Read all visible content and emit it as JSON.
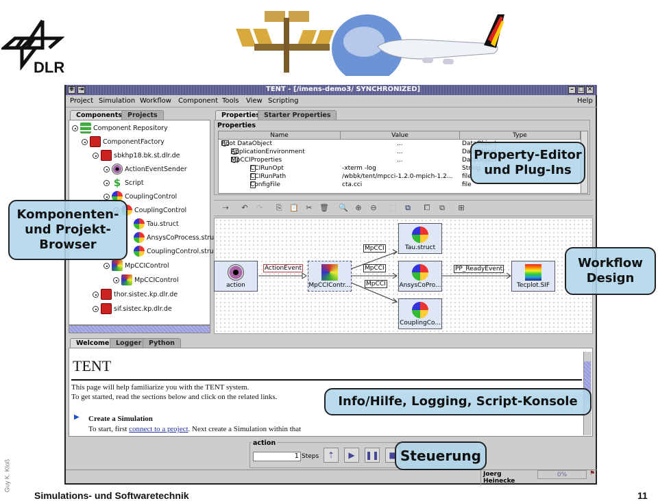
{
  "slide": {
    "logo_text": "DLR",
    "footer_title": "Simulations- und Softwaretechnik",
    "page_number": "11",
    "author": "Guy K. Kloß",
    "banner_description": "space station, globe and airplane banner"
  },
  "window": {
    "title": "TENT - [/imens-demo3/ SYNCHRONIZED]",
    "buttons": [
      "minimize",
      "maximize",
      "close"
    ]
  },
  "menubar": {
    "items": [
      "Project",
      "Simulation",
      "Workflow",
      "Component",
      "Tools",
      "View",
      "Scripting"
    ],
    "help": "Help"
  },
  "left_panel": {
    "tabs": [
      "Components",
      "Projects"
    ],
    "active_tab": "Components",
    "tree": [
      {
        "label": "Component Repository",
        "icon": "repository-icon",
        "level": 0
      },
      {
        "label": "ComponentFactory",
        "icon": "factory-icon",
        "level": 1
      },
      {
        "label": "sbkhp18.bk.st.dlr.de",
        "icon": "factory-icon",
        "level": 2
      },
      {
        "label": "ActionEventSender",
        "icon": "action-icon",
        "level": 3
      },
      {
        "label": "Script",
        "icon": "script-icon",
        "level": 3
      },
      {
        "label": "CouplingControl",
        "icon": "coupling-icon",
        "level": 3
      },
      {
        "label": "CouplingControl",
        "icon": "coupling-icon",
        "level": 4
      },
      {
        "label": "Tau.struct",
        "icon": "coupling-icon",
        "level": 5
      },
      {
        "label": "AnsysCoProcess.stru",
        "icon": "coupling-icon",
        "level": 5
      },
      {
        "label": "CouplingControl.stru",
        "icon": "coupling-icon",
        "level": 5
      },
      {
        "label": "MpCCIControl",
        "icon": "mpcci-icon",
        "level": 3
      },
      {
        "label": "MpCCIControl",
        "icon": "mpcci-icon",
        "level": 4
      },
      {
        "label": "thor.sistec.kp.dlr.de",
        "icon": "factory-icon",
        "level": 2
      },
      {
        "label": "sif.sistec.kp.dlr.de",
        "icon": "factory-icon",
        "level": 2
      }
    ]
  },
  "properties_panel": {
    "tabs": [
      "Properties",
      "Starter Properties"
    ],
    "active_tab": "Properties",
    "group_label": "Properties",
    "columns": [
      "Name",
      "Value",
      "Type"
    ],
    "rows": [
      {
        "name": "Root DataObject",
        "value": "...",
        "type": "DataObject",
        "kind": "folder",
        "level": 0
      },
      {
        "name": "ApplicationEnvironment",
        "value": "...",
        "type": "DataObject",
        "kind": "folder",
        "level": 1
      },
      {
        "name": "MpCCIProperties",
        "value": "...",
        "type": "DataObject",
        "kind": "folder",
        "level": 1
      },
      {
        "name": "CCIRunOpt",
        "value": "-xterm -log",
        "type": "String",
        "kind": "file",
        "level": 2
      },
      {
        "name": "CCIRunPath",
        "value": "/wbbk/tent/mpcci-1.2.0-mpich-1.2...",
        "type": "file",
        "kind": "file",
        "level": 2
      },
      {
        "name": "ConfigFile",
        "value": "cta.cci",
        "type": "file",
        "kind": "file",
        "level": 2
      }
    ]
  },
  "workflow_toolbar": {
    "tools": [
      "connect-icon",
      "undo-icon",
      "redo-icon",
      "copy-icon",
      "paste-icon",
      "cut-icon",
      "delete-icon",
      "zoom-icon",
      "zoom-in-icon",
      "zoom-out-icon",
      "select-area-icon",
      "group-icon",
      "bring-front-icon",
      "send-back-icon",
      "layout-icon"
    ]
  },
  "workflow": {
    "nodes": [
      {
        "id": "action",
        "label": "action",
        "icon": "action-icon"
      },
      {
        "id": "mpcci",
        "label": "MpCCIContr...",
        "icon": "mpcci-icon",
        "selected": true
      },
      {
        "id": "tau",
        "label": "Tau.struct",
        "icon": "coupling-icon"
      },
      {
        "id": "ansys",
        "label": "AnsysCoPro...",
        "icon": "coupling-icon"
      },
      {
        "id": "coupling",
        "label": "CouplingCo...",
        "icon": "coupling-icon"
      },
      {
        "id": "tecplot",
        "label": "Tecplot.SIF",
        "icon": "tecplot-icon"
      }
    ],
    "edges": [
      {
        "from": "action",
        "to": "mpcci",
        "label": "ActionEvent"
      },
      {
        "from": "mpcci",
        "to": "tau",
        "label": "MpCCI"
      },
      {
        "from": "mpcci",
        "to": "ansys",
        "label": "MpCCI"
      },
      {
        "from": "mpcci",
        "to": "coupling",
        "label": "MpCCI"
      },
      {
        "from": "ansys",
        "to": "tecplot",
        "label": "PP_ReadyEvent"
      }
    ]
  },
  "bottom_panel": {
    "tabs": [
      "Welcome",
      "Logger",
      "Python"
    ],
    "active_tab": "Welcome",
    "title": "TENT",
    "intro_line1": "This page will help familiarize you with the TENT system.",
    "intro_line2": "To get started, read the sections below and click on the related links.",
    "section_heading": "Create a Simulation",
    "section_text_before": "To start, first ",
    "section_link": "connect to a project",
    "section_text_after": ". Next create a Simulation within that"
  },
  "control": {
    "group_label": "action",
    "steps_value": "1",
    "steps_label": "Steps",
    "buttons": [
      "step-icon",
      "play-icon",
      "pause-icon",
      "stop-icon"
    ]
  },
  "statusbar": {
    "user": "Joerg Heinecke",
    "progress": "0%"
  },
  "callouts": {
    "browser": [
      "Komponenten-",
      "und Projekt-",
      "Browser"
    ],
    "property": [
      "Property-Editor",
      "und Plug-Ins"
    ],
    "workflow": [
      "Workflow",
      "Design"
    ],
    "info": "Info/Hilfe, Logging, Script-Konsole",
    "control": "Steuerung"
  }
}
